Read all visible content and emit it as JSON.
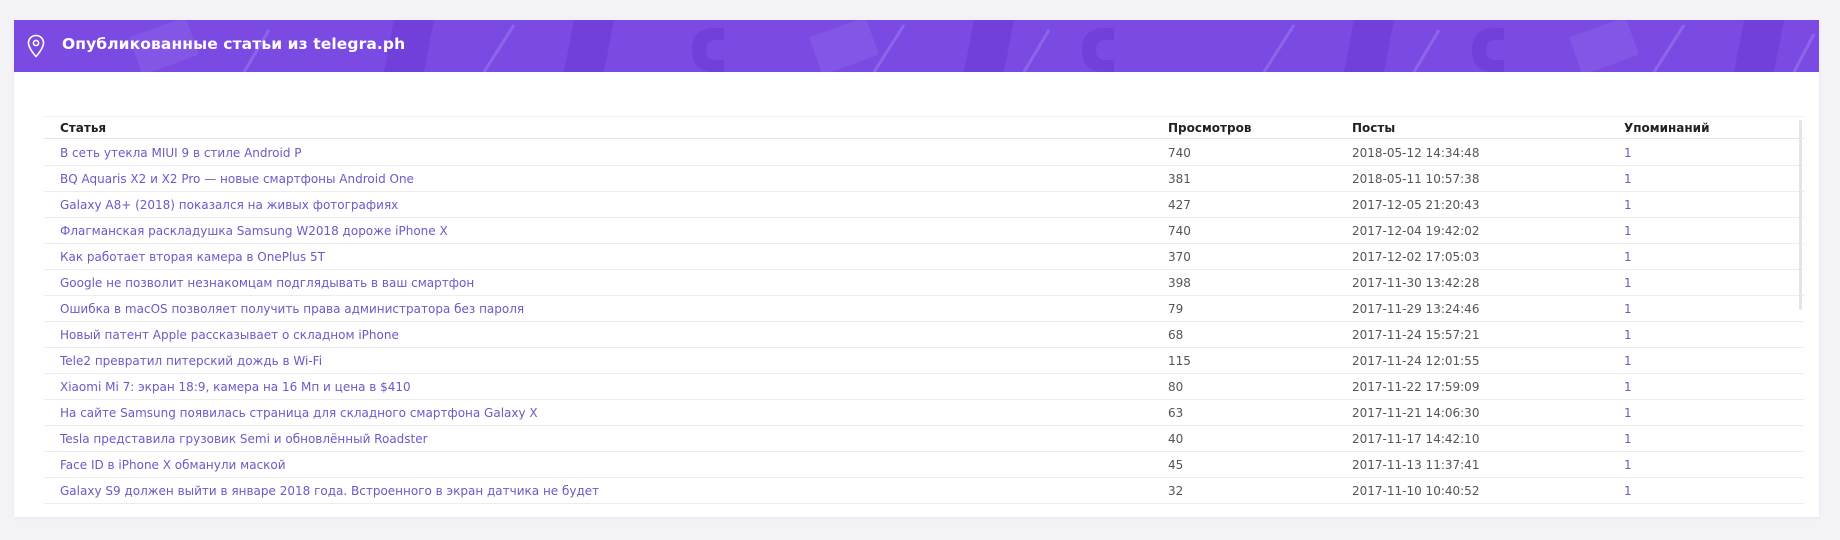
{
  "panel": {
    "title": "Опубликованные статьи из telegra.ph",
    "accent_color": "#7b4ae3",
    "icon": "location-pin-icon"
  },
  "table": {
    "columns": [
      "Статья",
      "Просмотров",
      "Посты",
      "Упоминаний"
    ],
    "rows": [
      {
        "title": "В сеть утекла MIUI 9 в стиле Android P",
        "views": "740",
        "date": "2018-05-12 14:34:48",
        "mentions": "1"
      },
      {
        "title": "BQ Aquaris X2 и X2 Pro — новые смартфоны Android One",
        "views": "381",
        "date": "2018-05-11 10:57:38",
        "mentions": "1"
      },
      {
        "title": "Galaxy A8+ (2018) показался на живых фотографиях",
        "views": "427",
        "date": "2017-12-05 21:20:43",
        "mentions": "1"
      },
      {
        "title": "Флагманская раскладушка Samsung W2018 дороже iPhone X",
        "views": "740",
        "date": "2017-12-04 19:42:02",
        "mentions": "1"
      },
      {
        "title": "Как работает вторая камера в OnePlus 5T",
        "views": "370",
        "date": "2017-12-02 17:05:03",
        "mentions": "1"
      },
      {
        "title": "Google не позволит незнакомцам подглядывать в ваш смартфон",
        "views": "398",
        "date": "2017-11-30 13:42:28",
        "mentions": "1"
      },
      {
        "title": "Ошибка в macOS позволяет получить права администратора без пароля",
        "views": "79",
        "date": "2017-11-29 13:24:46",
        "mentions": "1"
      },
      {
        "title": "Новый патент Apple рассказывает о складном iPhone",
        "views": "68",
        "date": "2017-11-24 15:57:21",
        "mentions": "1"
      },
      {
        "title": "Tele2 превратил питерский дождь в Wi-Fi",
        "views": "115",
        "date": "2017-11-24 12:01:55",
        "mentions": "1"
      },
      {
        "title": "Xiaomi Mi 7: экран 18:9, камера на 16 Мп и цена в $410",
        "views": "80",
        "date": "2017-11-22 17:59:09",
        "mentions": "1"
      },
      {
        "title": "На сайте Samsung появилась страница для складного смартфона Galaxy X",
        "views": "63",
        "date": "2017-11-21 14:06:30",
        "mentions": "1"
      },
      {
        "title": "Tesla представила грузовик Semi и обновлённый Roadster",
        "views": "40",
        "date": "2017-11-17 14:42:10",
        "mentions": "1"
      },
      {
        "title": "Face ID в iPhone X обманули маской",
        "views": "45",
        "date": "2017-11-13 11:37:41",
        "mentions": "1"
      },
      {
        "title": "Galaxy S9 должен выйти в январе 2018 года. Встроенного в экран датчика не будет",
        "views": "32",
        "date": "2017-11-10 10:40:52",
        "mentions": "1"
      }
    ]
  }
}
